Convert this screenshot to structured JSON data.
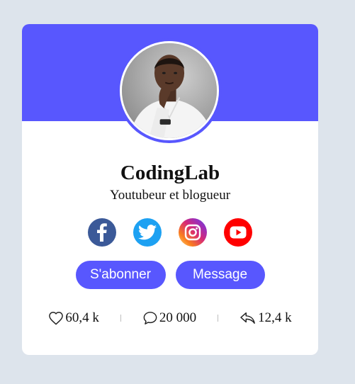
{
  "profile": {
    "name": "CodingLab",
    "job": "Youtubeur et blogueur"
  },
  "social": [
    {
      "network": "facebook",
      "icon": "facebook-icon",
      "color": "#3b5998"
    },
    {
      "network": "twitter",
      "icon": "twitter-icon",
      "color": "#1da1f2"
    },
    {
      "network": "instagram",
      "icon": "instagram-icon",
      "color": "#d62976"
    },
    {
      "network": "youtube",
      "icon": "youtube-icon",
      "color": "#ff0000"
    }
  ],
  "buttons": {
    "subscribe": "S'abonner",
    "message": "Message"
  },
  "stats": {
    "likes": "60,4 k",
    "comments": "20 000",
    "shares": "12,4 k"
  },
  "colors": {
    "accent": "#5857fe",
    "background": "#dde4ec",
    "card": "#ffffff"
  }
}
